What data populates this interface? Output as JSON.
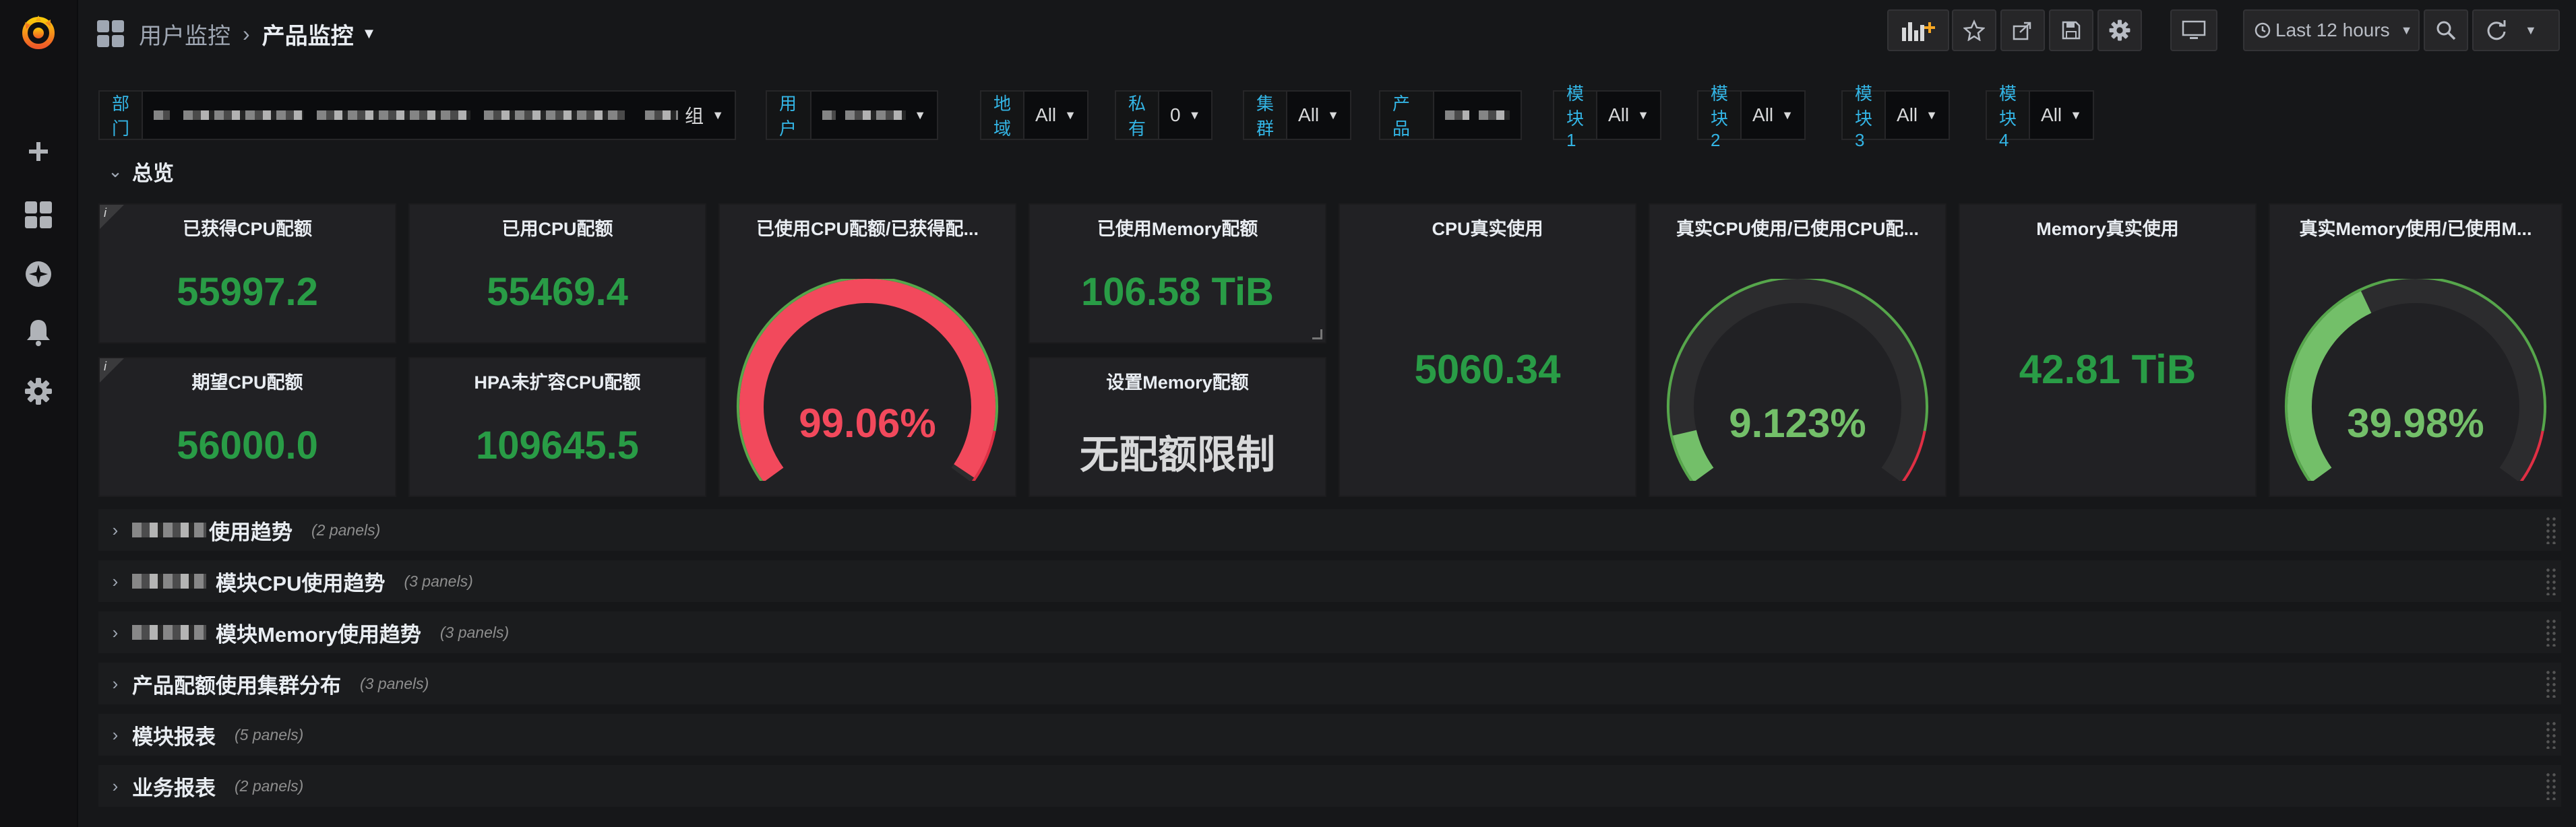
{
  "breadcrumb": {
    "parent": "用户监控",
    "current": "产品监控"
  },
  "toolbar": {
    "time_range": "Last 12 hours"
  },
  "variables": [
    {
      "label": "部门",
      "value": "",
      "tail": "组"
    },
    {
      "label": "用户",
      "value": ""
    },
    {
      "label": "地域",
      "value": "All"
    },
    {
      "label": "私有",
      "value": "0"
    },
    {
      "label": "集群",
      "value": "All"
    },
    {
      "label": "产品",
      "value": ""
    },
    {
      "label": "模块1",
      "value": "All"
    },
    {
      "label": "模块2",
      "value": "All"
    },
    {
      "label": "模块3",
      "value": "All"
    },
    {
      "label": "模块4",
      "value": "All"
    }
  ],
  "overview": {
    "title": "总览",
    "stats": {
      "obtained_cpu": {
        "title": "已获得CPU配额",
        "value": "55997.2"
      },
      "used_cpu": {
        "title": "已用CPU配额",
        "value": "55469.4"
      },
      "expected_cpu": {
        "title": "期望CPU配额",
        "value": "56000.0"
      },
      "hpa_cpu": {
        "title": "HPA未扩容CPU配额",
        "value": "109645.5"
      },
      "used_mem": {
        "title": "已使用Memory配额",
        "value": "106.58 TiB"
      },
      "set_mem": {
        "title": "设置Memory配额",
        "value": "无配额限制"
      },
      "cpu_real": {
        "title": "CPU真实使用",
        "value": "5060.34"
      },
      "mem_real": {
        "title": "Memory真实使用",
        "value": "42.81 TiB"
      }
    },
    "gauges": {
      "cpu_ratio": {
        "title": "已使用CPU配额/已获得配...",
        "value": "99.06%",
        "fraction": 0.9906,
        "color": "#f2495c"
      },
      "real_cpu_ratio": {
        "title": "真实CPU使用/已使用CPU配...",
        "value": "9.123%",
        "fraction": 0.09123,
        "color": "#73bf69"
      },
      "real_mem_ratio": {
        "title": "真实Memory使用/已使用M...",
        "value": "39.98%",
        "fraction": 0.3998,
        "color": "#73bf69"
      }
    }
  },
  "rows": [
    {
      "title": "使用趋势",
      "count": "(2 panels)",
      "blurred": true
    },
    {
      "title": "模块CPU使用趋势",
      "count": "(3 panels)",
      "blurred": true
    },
    {
      "title": "模块Memory使用趋势",
      "count": "(3 panels)",
      "blurred": true
    },
    {
      "title": "产品配额使用集群分布",
      "count": "(3 panels)",
      "blurred": false
    },
    {
      "title": "模块报表",
      "count": "(5 panels)",
      "blurred": false
    },
    {
      "title": "业务报表",
      "count": "(2 panels)",
      "blurred": false
    }
  ],
  "colors": {
    "green": "#299c46",
    "red": "#f2495c",
    "label_blue": "#33b5e5",
    "gauge_bg": "#2c2c2e",
    "threshold_green": "#56a64b",
    "threshold_red": "#e02f44"
  }
}
